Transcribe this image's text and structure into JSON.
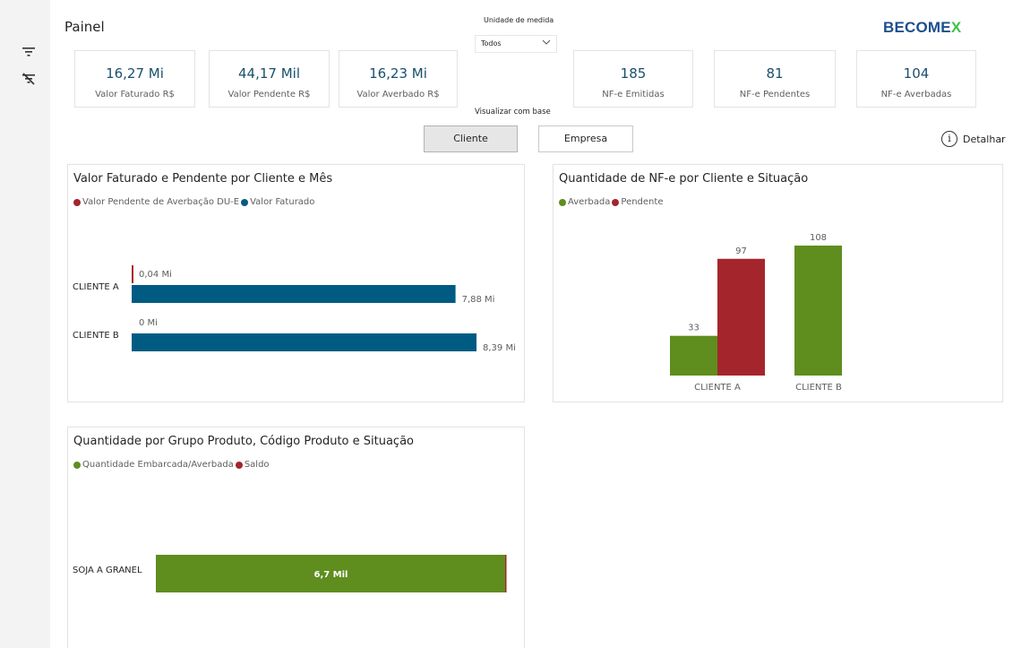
{
  "header": {
    "title": "Painel",
    "logo_main": "BECOME",
    "logo_accent": "X",
    "unit_label": "Unidade de medida",
    "unit_select_value": "Todos"
  },
  "kpis": [
    {
      "value": "16,27 Mi",
      "label": "Valor Faturado R$"
    },
    {
      "value": "44,17 Mil",
      "label": "Valor Pendente R$"
    },
    {
      "value": "16,23 Mi",
      "label": "Valor Averbado R$"
    },
    {
      "value": "185",
      "label": "NF-e Emitidas"
    },
    {
      "value": "81",
      "label": "NF-e Pendentes"
    },
    {
      "value": "104",
      "label": "NF-e Averbadas"
    }
  ],
  "view": {
    "label": "Visualizar com base",
    "cliente_button": "Cliente",
    "empresa_button": "Empresa",
    "selected": "Cliente"
  },
  "detail": {
    "icon_glyph": "i",
    "label": "Detalhar"
  },
  "colors": {
    "blue": "#005b83",
    "red": "#a4262c",
    "green": "#5f8d1e"
  },
  "chart_data": [
    {
      "type": "bar",
      "orientation": "horizontal",
      "title": "Valor Faturado e Pendente por Cliente e Mês",
      "categories": [
        "CLIENTE A",
        "CLIENTE B"
      ],
      "series": [
        {
          "name": "Valor Pendente de Averbação DU-E",
          "color": "#a4262c",
          "values": [
            0.04,
            0.0
          ],
          "labels": [
            "0,04 Mi",
            "0 Mi"
          ]
        },
        {
          "name": "Valor Faturado",
          "color": "#005b83",
          "values": [
            7.88,
            8.39
          ],
          "labels": [
            "7,88 Mi",
            "8,39 Mi"
          ]
        }
      ],
      "unit": "Mi",
      "xlim": [
        0,
        8.39
      ]
    },
    {
      "type": "bar",
      "orientation": "vertical",
      "title": "Quantidade de NF-e por Cliente e Situação",
      "categories": [
        "CLIENTE A",
        "CLIENTE B"
      ],
      "series": [
        {
          "name": "Averbada",
          "color": "#5f8d1e",
          "values": [
            33,
            108
          ]
        },
        {
          "name": "Pendente",
          "color": "#a4262c",
          "values": [
            97,
            null
          ]
        }
      ],
      "ylim": [
        0,
        108
      ]
    },
    {
      "type": "bar",
      "orientation": "horizontal",
      "stacked": true,
      "title": "Quantidade por Grupo Produto, Código Produto e Situação",
      "categories": [
        "SOJA A GRANEL"
      ],
      "series": [
        {
          "name": "Quantidade Embarcada/Averbada",
          "color": "#5f8d1e",
          "values": [
            6.7
          ],
          "labels": [
            "6,7 Mil"
          ]
        },
        {
          "name": "Saldo",
          "color": "#a4262c",
          "values": [
            0.0
          ]
        }
      ],
      "unit": "Mil",
      "xlim": [
        0,
        6.7
      ]
    }
  ]
}
